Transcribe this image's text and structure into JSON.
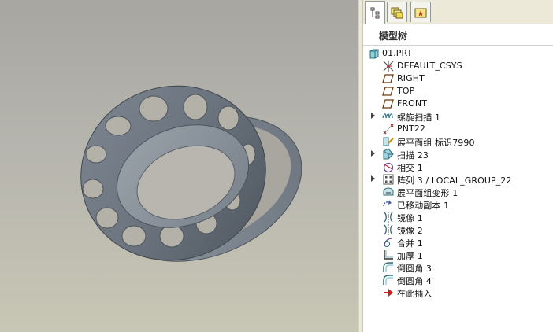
{
  "panel": {
    "tabs": [
      {
        "name": "model-tree-tab-icon"
      },
      {
        "name": "layers-tab-icon"
      },
      {
        "name": "favorites-tab-icon"
      }
    ],
    "header_title": "模型树"
  },
  "tree": {
    "root": "01.PRT",
    "items": [
      {
        "label": "DEFAULT_CSYS",
        "icon": "csys-icon",
        "expandable": false
      },
      {
        "label": "RIGHT",
        "icon": "datum-plane-icon",
        "expandable": false
      },
      {
        "label": "TOP",
        "icon": "datum-plane-icon",
        "expandable": false
      },
      {
        "label": "FRONT",
        "icon": "datum-plane-icon",
        "expandable": false
      },
      {
        "label": "螺旋扫描 1",
        "icon": "helical-sweep-icon",
        "expandable": true
      },
      {
        "label": "PNT22",
        "icon": "datum-point-icon",
        "expandable": false
      },
      {
        "label": "展平面组 标识7990",
        "icon": "flatten-quilt-icon",
        "expandable": false
      },
      {
        "label": "扫描 23",
        "icon": "sweep-icon",
        "expandable": true
      },
      {
        "label": "相交 1",
        "icon": "intersect-icon",
        "expandable": false
      },
      {
        "label": "阵列 3 / LOCAL_GROUP_22",
        "icon": "pattern-icon",
        "expandable": true
      },
      {
        "label": "展平面组变形 1",
        "icon": "flatten-deform-icon",
        "expandable": false
      },
      {
        "label": "已移动副本 1",
        "icon": "moved-copy-icon",
        "expandable": false
      },
      {
        "label": "镜像 1",
        "icon": "mirror-icon",
        "expandable": false
      },
      {
        "label": "镜像 2",
        "icon": "mirror-icon",
        "expandable": false
      },
      {
        "label": "合并 1",
        "icon": "merge-icon",
        "expandable": false
      },
      {
        "label": "加厚 1",
        "icon": "thicken-icon",
        "expandable": false
      },
      {
        "label": "倒圆角 3",
        "icon": "round-icon",
        "expandable": false
      },
      {
        "label": "倒圆角 4",
        "icon": "round-icon",
        "expandable": false
      },
      {
        "label": "在此插入",
        "icon": "insert-here-arrow-icon",
        "expandable": false
      }
    ]
  }
}
